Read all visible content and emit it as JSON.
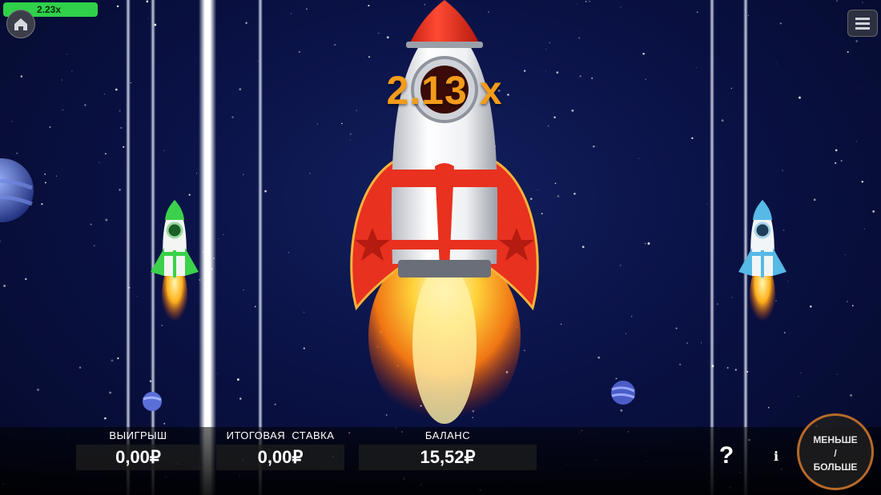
{
  "hud": {
    "progress_label": "2.23x",
    "progress_color": "#2fd14a"
  },
  "game": {
    "multiplier": "2.13 x",
    "multiplier_color": "#f39b1a",
    "main_rocket_color": "#e8311f",
    "side_rockets": [
      "green",
      "blue"
    ]
  },
  "stats": {
    "win_label": "ВЫИГРЫШ",
    "win_value": "0,00₽",
    "total_bet_label": "ИТОГОВАЯ  СТАВКА",
    "total_bet_value": "0,00₽",
    "balance_label": "БАЛАНС",
    "balance_value": "15,52₽"
  },
  "controls": {
    "help_label": "?",
    "info_label": "i",
    "less_more_line1": "МЕНЬШЕ",
    "less_more_line2": "/",
    "less_more_line3": "БОЛЬШЕ",
    "home_icon": "home-icon",
    "menu_icon": "hamburger-menu-icon"
  }
}
